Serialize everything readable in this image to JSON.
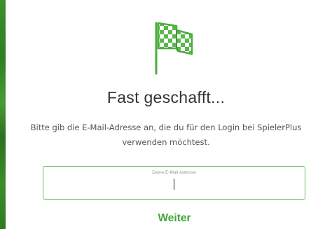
{
  "page": {
    "title": "Fast geschafft...",
    "instruction": "Bitte gib die E-Mail-Adresse an, die du für den Login bei SpielerPlus verwenden möchtest."
  },
  "email": {
    "label": "Deine E-Mail Adresse",
    "value": ""
  },
  "actions": {
    "continue_label": "Weiter"
  },
  "icons": {
    "header_icon": "checkered-flag-icon"
  },
  "colors": {
    "accent": "#43a63a",
    "border": "#65c25a",
    "strip": "#3a8a2b",
    "title": "#333333",
    "text": "#555555"
  }
}
